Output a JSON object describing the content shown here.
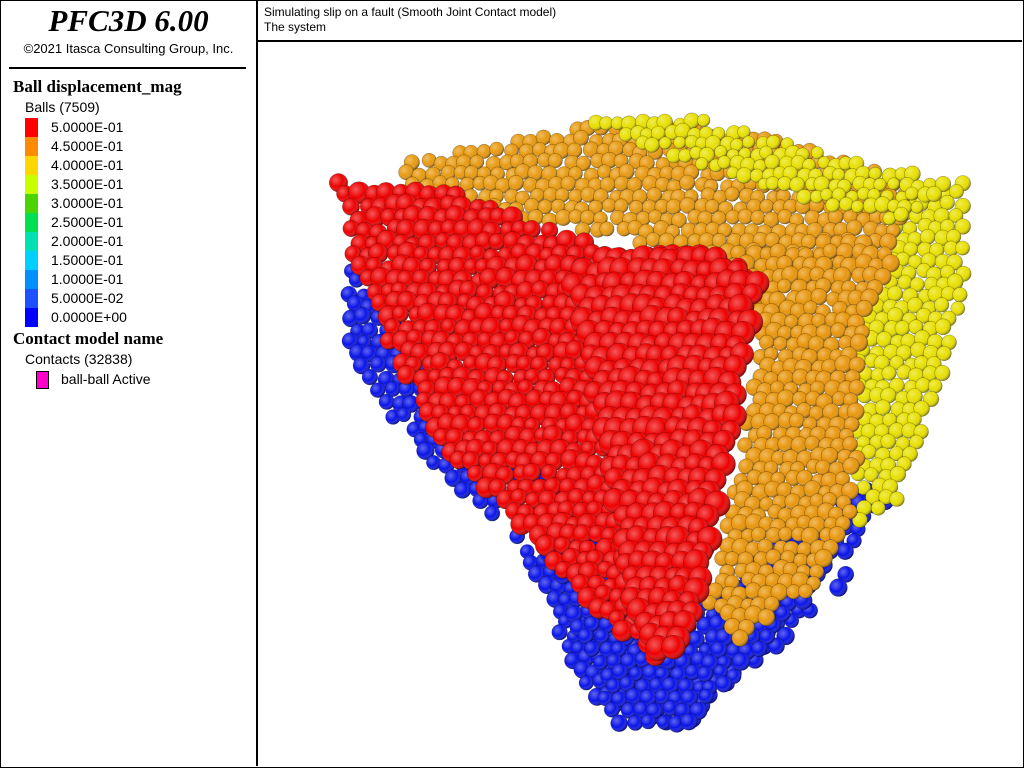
{
  "app": {
    "title": "PFC3D 6.00",
    "copyright": "©2021 Itasca Consulting Group, Inc."
  },
  "header": {
    "line1": "Simulating slip on a fault (Smooth Joint Contact model)",
    "line2": "The system"
  },
  "legend": {
    "ball_title": "Ball displacement_mag",
    "ball_count": "Balls (7509)",
    "entries": [
      {
        "value": "5.0000E-01",
        "color": "#ff0000"
      },
      {
        "value": "4.5000E-01",
        "color": "#ff8c00"
      },
      {
        "value": "4.0000E-01",
        "color": "#ffd700"
      },
      {
        "value": "3.5000E-01",
        "color": "#c8ff00"
      },
      {
        "value": "3.0000E-01",
        "color": "#4cd400"
      },
      {
        "value": "2.5000E-01",
        "color": "#00e050"
      },
      {
        "value": "2.0000E-01",
        "color": "#00e0b0"
      },
      {
        "value": "1.5000E-01",
        "color": "#00d0ff"
      },
      {
        "value": "1.0000E-01",
        "color": "#0090ff"
      },
      {
        "value": "5.0000E-02",
        "color": "#1f50ff"
      },
      {
        "value": "0.0000E+00",
        "color": "#0000ff"
      }
    ],
    "contact_title": "Contact model name",
    "contact_count": "Contacts (32838)",
    "contact_entry": "ball-ball Active",
    "contact_color": "#ff00cc"
  },
  "scene": {
    "face_colors": {
      "bottom": "#0a14e8",
      "top": "#e89a10",
      "right": "#e8e000",
      "red": "#ee0000",
      "fault": "#e8960c"
    }
  }
}
